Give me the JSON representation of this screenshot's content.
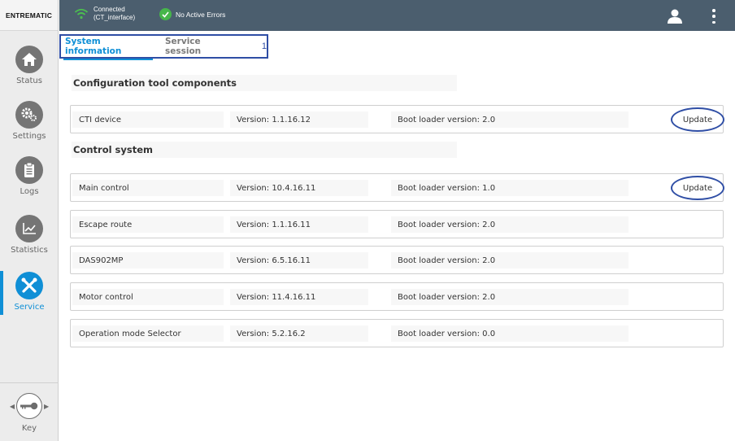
{
  "brand": {
    "name": "ENTREMATIC"
  },
  "topbar": {
    "connection_status": "Connected",
    "connection_detail": "(CT_interface)",
    "error_status": "No Active Errors",
    "icons": {
      "connection": "wifi-icon",
      "errors": "check-circle-icon",
      "user": "user-icon",
      "menu": "kebab-menu-icon"
    }
  },
  "sidebar": {
    "items": [
      {
        "label": "Status",
        "icon": "home-icon",
        "active": false
      },
      {
        "label": "Settings",
        "icon": "gears-icon",
        "active": false
      },
      {
        "label": "Logs",
        "icon": "document-icon",
        "active": false
      },
      {
        "label": "Statistics",
        "icon": "line-chart-icon",
        "active": false
      },
      {
        "label": "Service",
        "icon": "tools-icon",
        "active": true
      }
    ],
    "key": {
      "label": "Key",
      "icon": "key-icon"
    }
  },
  "tabs": {
    "items": [
      {
        "label": "System information",
        "active": true
      },
      {
        "label": "Service session",
        "active": false
      }
    ],
    "marker": "1"
  },
  "sections": {
    "config": {
      "title": "Configuration tool components",
      "rows": [
        {
          "name": "CTI device",
          "version": "Version: 1.1.16.12",
          "boot": "Boot loader version: 2.0",
          "action": "Update"
        }
      ]
    },
    "control": {
      "title": "Control system",
      "rows": [
        {
          "name": "Main control",
          "version": "Version: 10.4.16.11",
          "boot": "Boot loader version: 1.0",
          "action": "Update"
        },
        {
          "name": "Escape route",
          "version": "Version: 1.1.16.11",
          "boot": "Boot loader version: 2.0"
        },
        {
          "name": "DAS902MP",
          "version": "Version: 6.5.16.11",
          "boot": "Boot loader version: 2.0"
        },
        {
          "name": "Motor control",
          "version": "Version: 11.4.16.11",
          "boot": "Boot loader version: 2.0"
        },
        {
          "name": "Operation mode Selector",
          "version": "Version: 5.2.16.2",
          "boot": "Boot loader version: 0.0"
        }
      ]
    }
  },
  "colors": {
    "accent": "#0f8fd6",
    "topbar": "#4b5e6e",
    "highlight": "#2f4ea5",
    "ok": "#46b64a"
  }
}
